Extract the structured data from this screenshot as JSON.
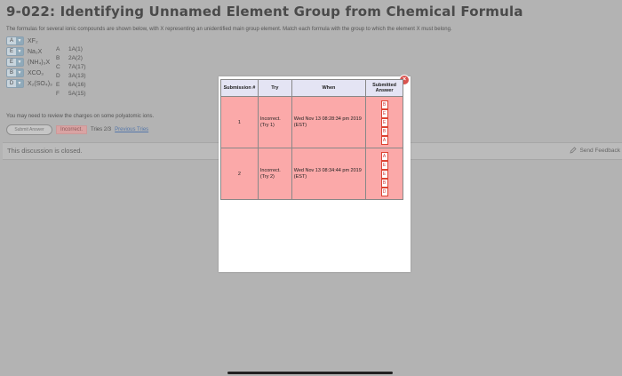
{
  "page": {
    "title": "9-022: Identifying Unnamed Element Group from Chemical Formula",
    "instructions": "The formulas for several ionic compounds are shown below, with X representing an unidentified main group element. Match each formula with the group to which the element X must belong."
  },
  "formulas": [
    {
      "value": "A",
      "formula": "XF₂"
    },
    {
      "value": "E",
      "formula": "Na₂X"
    },
    {
      "value": "E",
      "formula": "(NH₄)₃X"
    },
    {
      "value": "B",
      "formula": "XCO₃"
    },
    {
      "value": "D",
      "formula": "X₂(SO₄)₃"
    }
  ],
  "groups": [
    {
      "letter": "A",
      "name": "1A(1)"
    },
    {
      "letter": "B",
      "name": "2A(2)"
    },
    {
      "letter": "C",
      "name": "7A(17)"
    },
    {
      "letter": "D",
      "name": "3A(13)"
    },
    {
      "letter": "E",
      "name": "6A(16)"
    },
    {
      "letter": "F",
      "name": "5A(15)"
    }
  ],
  "hint": "You may need to review the charges on some polyatomic ions.",
  "actions": {
    "submit_label": "Submit Answer",
    "result": "Incorrect.",
    "tries": "Tries 2/3",
    "previous_tries": "Previous Tries"
  },
  "discussion": {
    "message": "This discussion is closed.",
    "feedback": "Send Feedback"
  },
  "modal": {
    "headers": {
      "submission": "Submission #",
      "try": "Try",
      "when": "When",
      "answer": "Submitted Answer"
    },
    "rows": [
      {
        "num": "1",
        "status": "Incorrect.",
        "try": "(Try 1)",
        "when": "Wed Nov 13 08:28:34 pm 2019 (EST)",
        "answers": [
          "B",
          "E",
          "E",
          "B",
          "A"
        ]
      },
      {
        "num": "2",
        "status": "Incorrect.",
        "try": "(Try 2)",
        "when": "Wed Nov 13 08:34:44 pm 2019 (EST)",
        "answers": [
          "A",
          "E",
          "E",
          "B",
          "D"
        ]
      }
    ]
  },
  "colors": {
    "background": "#b3b3b3",
    "incorrect_row": "#fba9a9",
    "header": "#e4e4f4",
    "close": "#d9534f"
  }
}
